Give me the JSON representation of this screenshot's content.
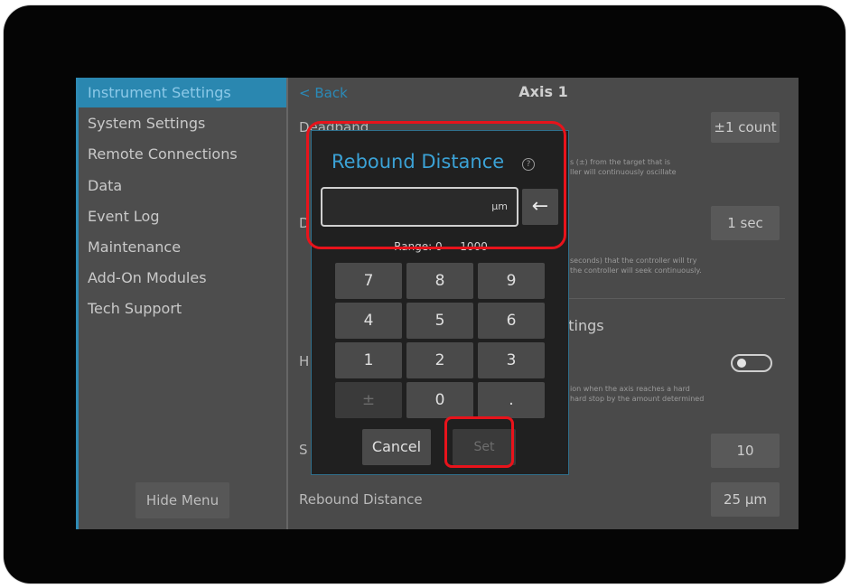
{
  "sidebar": {
    "items": [
      {
        "label": "Instrument Settings",
        "active": true
      },
      {
        "label": "System Settings"
      },
      {
        "label": "Remote Connections"
      },
      {
        "label": "Data"
      },
      {
        "label": "Event Log"
      },
      {
        "label": "Maintenance"
      },
      {
        "label": "Add-On Modules"
      },
      {
        "label": "Tech Support"
      }
    ],
    "hide_menu_label": "Hide Menu"
  },
  "header": {
    "back_label": "< Back",
    "title": "Axis 1"
  },
  "settings": {
    "deadband": {
      "label": "Deadband",
      "value": "±1 count",
      "desc_line1": "s (±) from the target that is",
      "desc_line2": "ller will continuously oscillate"
    },
    "duration": {
      "label": "D",
      "value": "1 sec",
      "desc_line1": "seconds) that the controller will try",
      "desc_line2": "the controller will seek continuously."
    },
    "section_heading": "ttings",
    "hardstop": {
      "label": "H",
      "desc_line1": "ion when the axis reaches a hard",
      "desc_line2": "hard stop by the amount determined",
      "toggle_on": false
    },
    "steps": {
      "label": "S",
      "value": "10"
    },
    "rebound": {
      "label": "Rebound Distance",
      "value": "25 µm"
    }
  },
  "dialog": {
    "title": "Rebound Distance",
    "help_icon": "?",
    "input_value": "",
    "unit": "µm",
    "backspace_icon": "←",
    "range": "Range: 0 — 1000",
    "keys": [
      "7",
      "8",
      "9",
      "4",
      "5",
      "6",
      "1",
      "2",
      "3",
      "±",
      "0",
      "."
    ],
    "cancel_label": "Cancel",
    "set_label": "Set"
  },
  "colors": {
    "accent": "#2a87b0",
    "highlight": "#e8131b"
  }
}
